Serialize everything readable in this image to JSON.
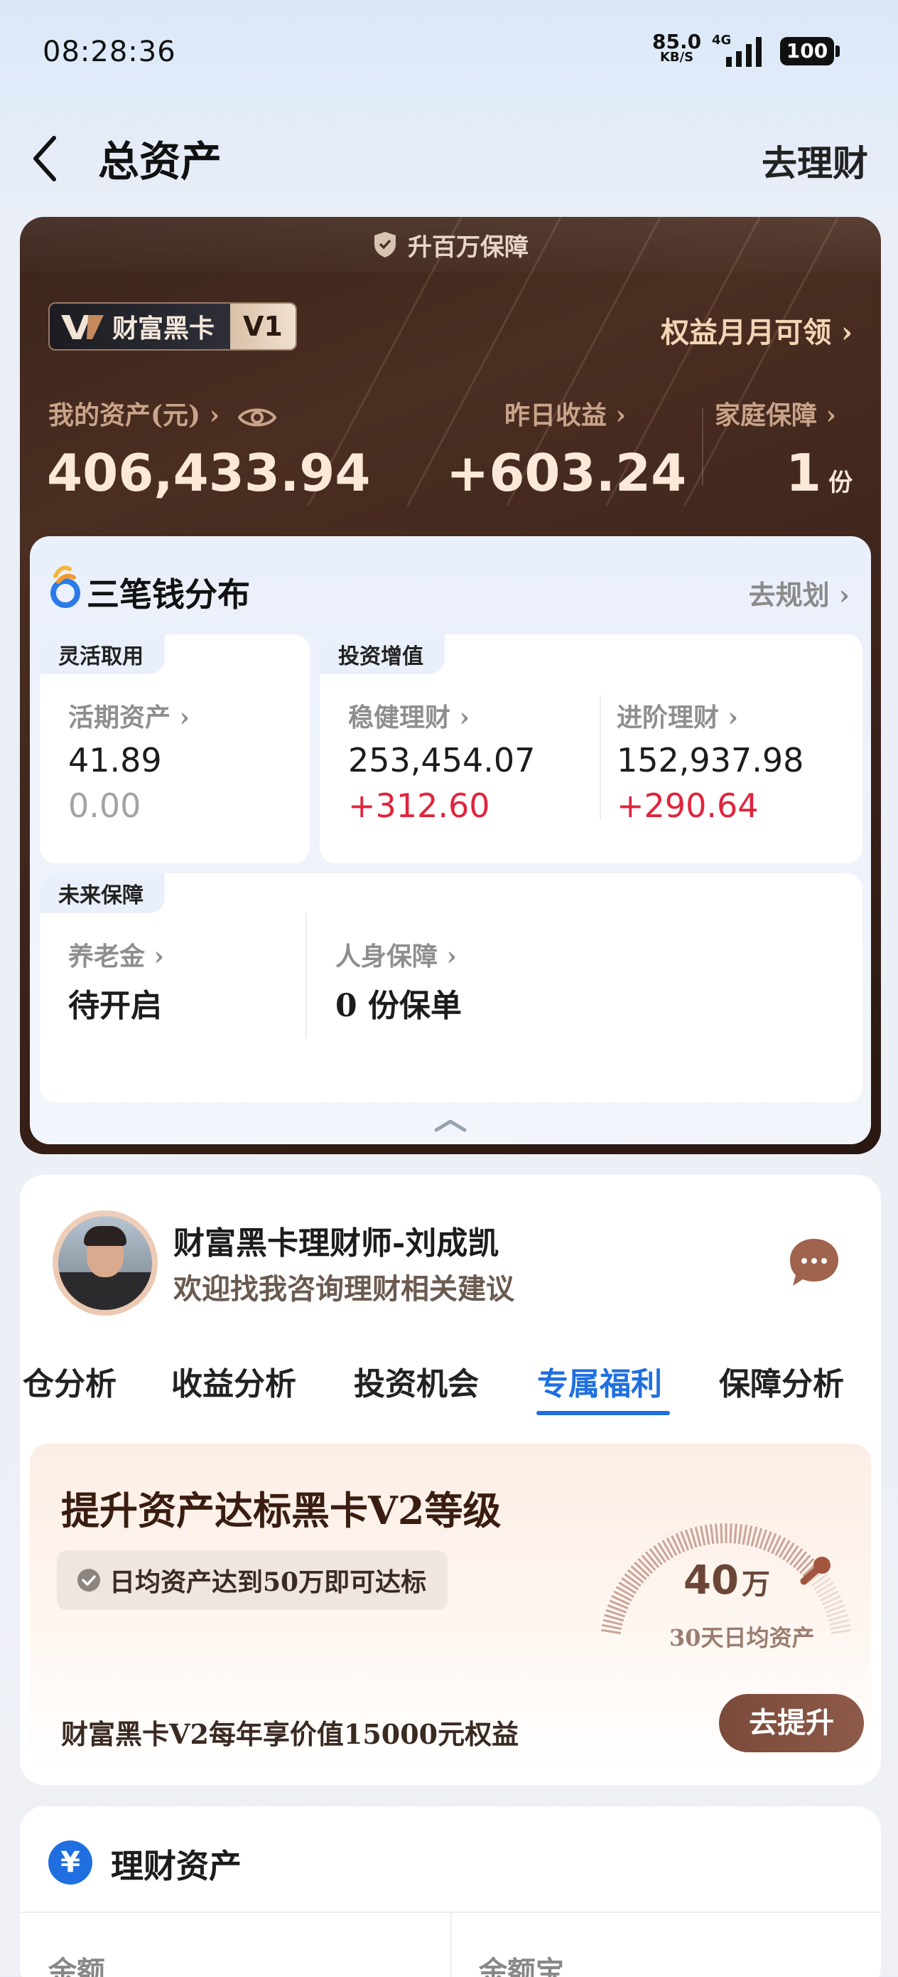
{
  "status_bar": {
    "time": "08:28:36",
    "net_speed": "85.0",
    "net_unit": "KB/S",
    "network": "4G",
    "battery": "100"
  },
  "header": {
    "title": "总资产",
    "action": "去理财"
  },
  "black_card": {
    "guarantee_banner": "升百万保障",
    "badge_name": "财富黑卡",
    "badge_level": "V1",
    "rights_link": "权益月月可领 ›",
    "assets_label": "我的资产(元) ›",
    "assets_value": "406,433.94",
    "yesterday_label": "昨日收益 ›",
    "yesterday_value": "+603.24",
    "family_label": "家庭保障 ›",
    "family_value": "1",
    "family_unit": "份"
  },
  "distribution": {
    "title": "三笔钱分布",
    "plan_link": "去规划 ›",
    "flexible": {
      "tag": "灵活取用",
      "label": "活期资产 ›",
      "value": "41.89",
      "change": "0.00"
    },
    "investment": {
      "tag": "投资增值",
      "steady_label": "稳健理财 ›",
      "steady_value": "253,454.07",
      "steady_change": "+312.60",
      "advanced_label": "进阶理财 ›",
      "advanced_value": "152,937.98",
      "advanced_change": "+290.64"
    },
    "future": {
      "tag": "未来保障",
      "pension_label": "养老金 ›",
      "pension_value": "待开启",
      "insurance_label": "人身保障 ›",
      "insurance_value": "0 份保单"
    }
  },
  "advisor": {
    "name": "财富黑卡理财师-刘成凯",
    "subtitle": "欢迎找我咨询理财相关建议"
  },
  "tabs": [
    "仓分析",
    "收益分析",
    "投资机会",
    "专属福利",
    "保障分析"
  ],
  "active_tab": "专属福利",
  "upgrade": {
    "title": "提升资产达标黑卡V2等级",
    "condition": "日均资产达到50万即可达标",
    "gauge_value": "40",
    "gauge_unit": "万",
    "gauge_label": "30天日均资产",
    "gauge_progress": 0.8,
    "note": "财富黑卡V2每年享价值15000元权益",
    "button": "去提升"
  },
  "finance": {
    "icon": "¥",
    "title": "理财资产",
    "col_left": "余额",
    "col_right": "余额宝"
  },
  "colors": {
    "accent_blue": "#1f6fe0",
    "gain_red": "#e0243c",
    "card_brown": "#3a2319"
  }
}
